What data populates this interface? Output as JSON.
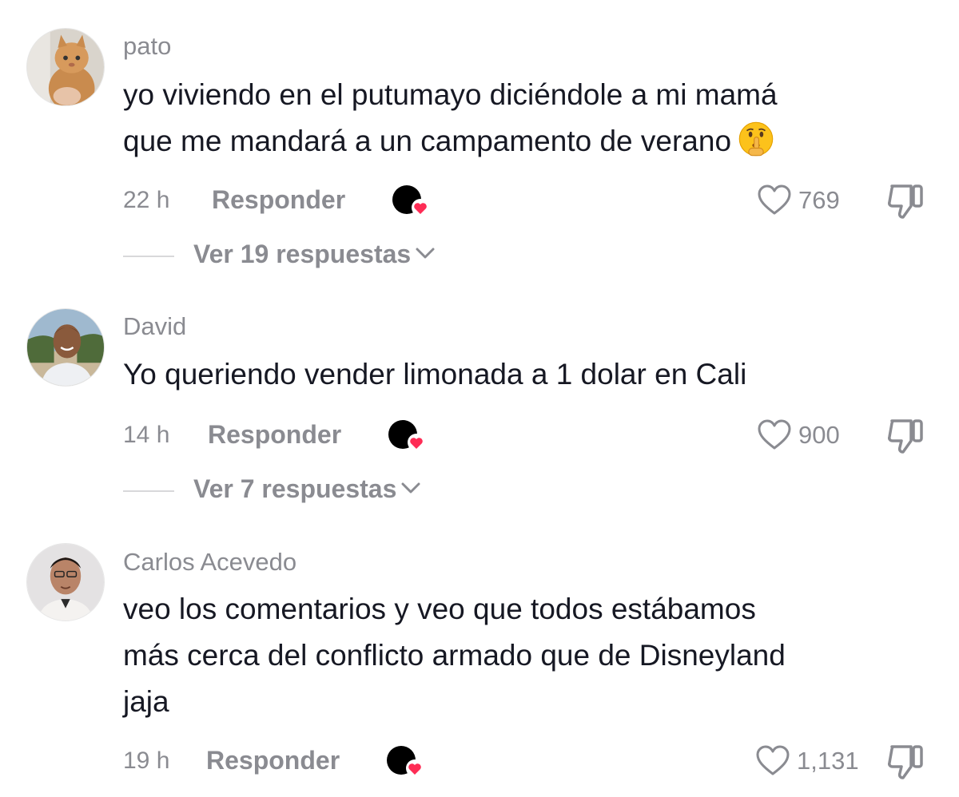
{
  "comments": [
    {
      "username": "pato",
      "text": "yo viviendo en el putumayo diciéndole a mi mamá\nque me mandará a un campamento de verano",
      "emoji_icon": "shushing-face-icon",
      "time": "22 h",
      "reply_label": "Responder",
      "likes": "769",
      "view_replies": "Ver 19 respuestas"
    },
    {
      "username": "David",
      "text": "Yo queriendo vender limonada a 1 dolar en Cali",
      "time": "14 h",
      "reply_label": "Responder",
      "likes": "900",
      "view_replies": "Ver 7 respuestas"
    },
    {
      "username": "Carlos Acevedo",
      "text": "veo los comentarios y veo que todos estábamos\nmás cerca del conflicto armado que de Disneyland\njaja",
      "time": "19 h",
      "reply_label": "Responder",
      "likes": "1,131"
    }
  ],
  "colors": {
    "text": "#161823",
    "muted": "#8a8b91",
    "heart_badge": "#fe2c55"
  }
}
